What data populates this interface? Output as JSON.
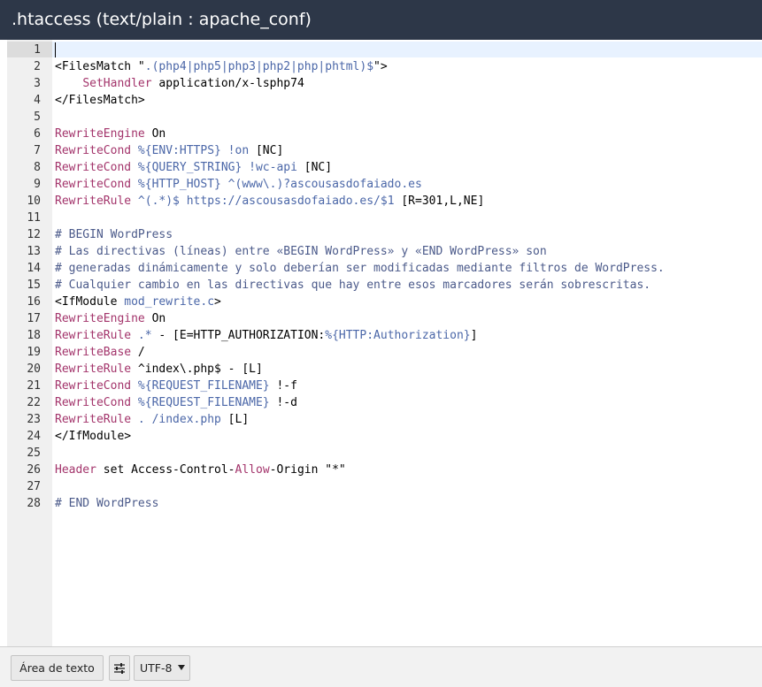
{
  "window": {
    "title": ".htaccess (text/plain : apache_conf)"
  },
  "colors": {
    "keyword": "#a3346b",
    "variable": "#4b67a8",
    "comment": "#4b5a8a",
    "text": "#000000"
  },
  "editor": {
    "lines": [
      {
        "num": "1",
        "segs": []
      },
      {
        "num": "2",
        "segs": [
          {
            "t": "<FilesMatch \"",
            "c": "plain"
          },
          {
            "t": ".(php4|php5|php3|php2|php|phtml)$",
            "c": "variable"
          },
          {
            "t": "\">",
            "c": "plain"
          }
        ]
      },
      {
        "num": "3",
        "segs": [
          {
            "t": "    ",
            "c": "plain"
          },
          {
            "t": "SetHandler",
            "c": "keyword"
          },
          {
            "t": " application/x-lsphp74",
            "c": "plain"
          }
        ]
      },
      {
        "num": "4",
        "segs": [
          {
            "t": "</FilesMatch>",
            "c": "plain"
          }
        ]
      },
      {
        "num": "5",
        "segs": []
      },
      {
        "num": "6",
        "segs": [
          {
            "t": "RewriteEngine",
            "c": "keyword"
          },
          {
            "t": " On",
            "c": "plain"
          }
        ]
      },
      {
        "num": "7",
        "segs": [
          {
            "t": "RewriteCond",
            "c": "keyword"
          },
          {
            "t": " ",
            "c": "plain"
          },
          {
            "t": "%{ENV:HTTPS}",
            "c": "variable"
          },
          {
            "t": " ",
            "c": "plain"
          },
          {
            "t": "!on",
            "c": "variable"
          },
          {
            "t": " [NC]",
            "c": "plain"
          }
        ]
      },
      {
        "num": "8",
        "segs": [
          {
            "t": "RewriteCond",
            "c": "keyword"
          },
          {
            "t": " ",
            "c": "plain"
          },
          {
            "t": "%{QUERY_STRING}",
            "c": "variable"
          },
          {
            "t": " ",
            "c": "plain"
          },
          {
            "t": "!wc-api",
            "c": "variable"
          },
          {
            "t": " [NC]",
            "c": "plain"
          }
        ]
      },
      {
        "num": "9",
        "segs": [
          {
            "t": "RewriteCond",
            "c": "keyword"
          },
          {
            "t": " ",
            "c": "plain"
          },
          {
            "t": "%{HTTP_HOST}",
            "c": "variable"
          },
          {
            "t": " ",
            "c": "plain"
          },
          {
            "t": "^(www\\.)?ascousasdofaiado.es",
            "c": "variable"
          }
        ]
      },
      {
        "num": "10",
        "segs": [
          {
            "t": "RewriteRule",
            "c": "keyword"
          },
          {
            "t": " ",
            "c": "plain"
          },
          {
            "t": "^(.*)$",
            "c": "variable"
          },
          {
            "t": " ",
            "c": "plain"
          },
          {
            "t": "https://ascousasdofaiado.es/$1",
            "c": "variable"
          },
          {
            "t": " [R=301,L,NE]",
            "c": "plain"
          }
        ]
      },
      {
        "num": "11",
        "segs": []
      },
      {
        "num": "12",
        "segs": [
          {
            "t": "# BEGIN WordPress",
            "c": "comment"
          }
        ]
      },
      {
        "num": "13",
        "segs": [
          {
            "t": "# Las directivas (líneas) entre «BEGIN WordPress» y «END WordPress» son",
            "c": "comment"
          }
        ]
      },
      {
        "num": "14",
        "segs": [
          {
            "t": "# generadas dinámicamente y solo deberían ser modificadas mediante filtros de WordPress.",
            "c": "comment"
          }
        ]
      },
      {
        "num": "15",
        "segs": [
          {
            "t": "# Cualquier cambio en las directivas que hay entre esos marcadores serán sobrescritas.",
            "c": "comment"
          }
        ]
      },
      {
        "num": "16",
        "segs": [
          {
            "t": "<IfModule ",
            "c": "plain"
          },
          {
            "t": "mod_rewrite.c",
            "c": "variable"
          },
          {
            "t": ">",
            "c": "plain"
          }
        ]
      },
      {
        "num": "17",
        "segs": [
          {
            "t": "RewriteEngine",
            "c": "keyword"
          },
          {
            "t": " On",
            "c": "plain"
          }
        ]
      },
      {
        "num": "18",
        "segs": [
          {
            "t": "RewriteRule",
            "c": "keyword"
          },
          {
            "t": " ",
            "c": "plain"
          },
          {
            "t": ".*",
            "c": "variable"
          },
          {
            "t": " - [E=HTTP_AUTHORIZATION:",
            "c": "plain"
          },
          {
            "t": "%{HTTP:Authorization}",
            "c": "variable"
          },
          {
            "t": "]",
            "c": "plain"
          }
        ]
      },
      {
        "num": "19",
        "segs": [
          {
            "t": "RewriteBase",
            "c": "keyword"
          },
          {
            "t": " /",
            "c": "plain"
          }
        ]
      },
      {
        "num": "20",
        "segs": [
          {
            "t": "RewriteRule",
            "c": "keyword"
          },
          {
            "t": " ^index\\.php$ - [L]",
            "c": "plain"
          }
        ]
      },
      {
        "num": "21",
        "segs": [
          {
            "t": "RewriteCond",
            "c": "keyword"
          },
          {
            "t": " ",
            "c": "plain"
          },
          {
            "t": "%{REQUEST_FILENAME}",
            "c": "variable"
          },
          {
            "t": " !-f",
            "c": "plain"
          }
        ]
      },
      {
        "num": "22",
        "segs": [
          {
            "t": "RewriteCond",
            "c": "keyword"
          },
          {
            "t": " ",
            "c": "plain"
          },
          {
            "t": "%{REQUEST_FILENAME}",
            "c": "variable"
          },
          {
            "t": " !-d",
            "c": "plain"
          }
        ]
      },
      {
        "num": "23",
        "segs": [
          {
            "t": "RewriteRule",
            "c": "keyword"
          },
          {
            "t": " ",
            "c": "plain"
          },
          {
            "t": ".",
            "c": "variable"
          },
          {
            "t": " ",
            "c": "plain"
          },
          {
            "t": "/index.php",
            "c": "variable"
          },
          {
            "t": " [L]",
            "c": "plain"
          }
        ]
      },
      {
        "num": "24",
        "segs": [
          {
            "t": "</IfModule>",
            "c": "plain"
          }
        ]
      },
      {
        "num": "25",
        "segs": []
      },
      {
        "num": "26",
        "segs": [
          {
            "t": "Header",
            "c": "keyword"
          },
          {
            "t": " set Access-Control-",
            "c": "plain"
          },
          {
            "t": "Allow",
            "c": "keyword"
          },
          {
            "t": "-Origin \"*\"",
            "c": "plain"
          }
        ]
      },
      {
        "num": "27",
        "segs": []
      },
      {
        "num": "28",
        "segs": [
          {
            "t": "# END WordPress",
            "c": "comment"
          }
        ]
      }
    ]
  },
  "statusbar": {
    "textarea_button": "Área de texto",
    "settings_icon": "sliders-icon",
    "encoding": "UTF-8"
  }
}
